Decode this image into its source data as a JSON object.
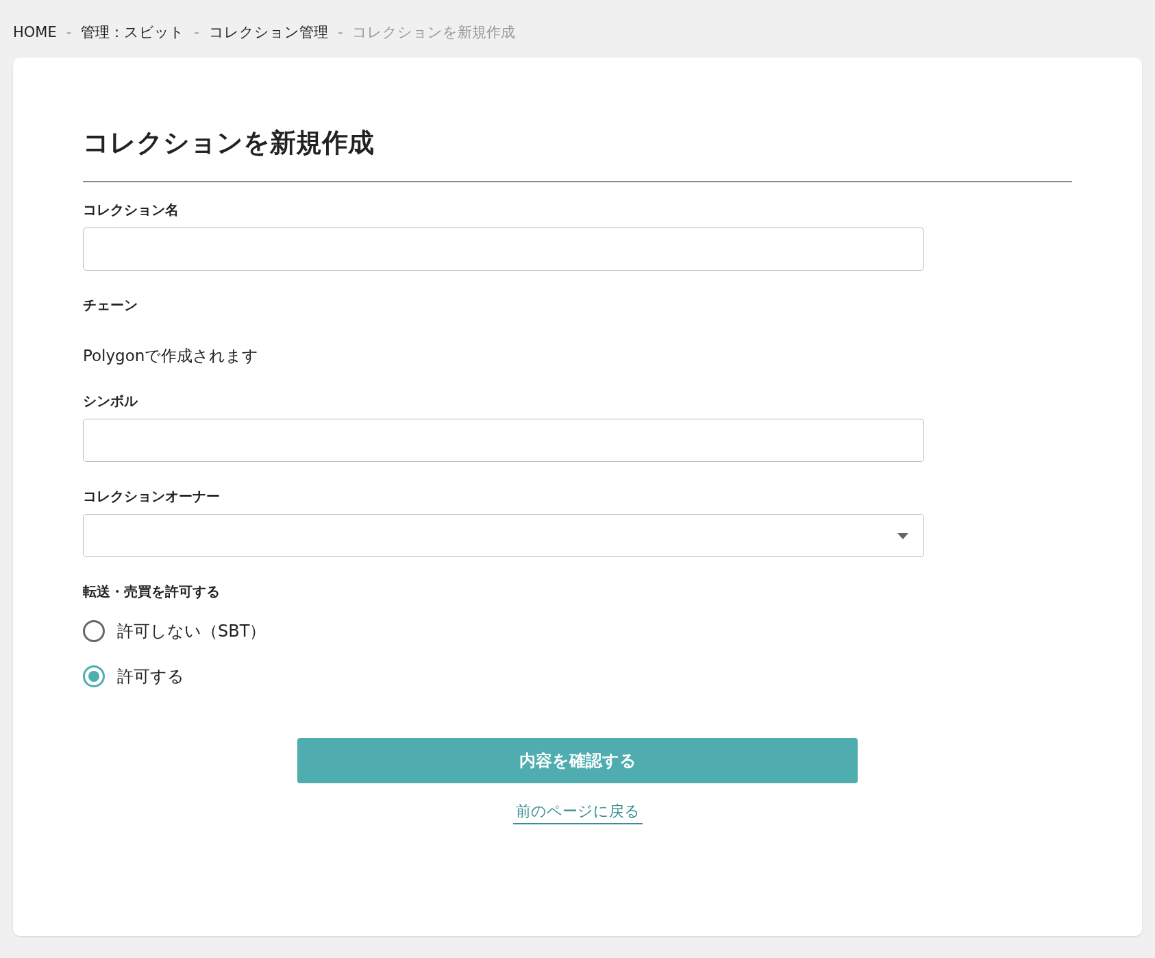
{
  "breadcrumb": [
    {
      "kind": "link",
      "label": "HOME"
    },
    {
      "kind": "separator",
      "label": "-"
    },
    {
      "kind": "link",
      "label": "管理：スビット"
    },
    {
      "kind": "separator",
      "label": "-"
    },
    {
      "kind": "link",
      "label": "コレクション管理"
    },
    {
      "kind": "separator",
      "label": "-"
    },
    {
      "kind": "current",
      "label": "コレクションを新規作成"
    }
  ],
  "title": "コレクションを新規作成",
  "fields": [
    {
      "kind": "text",
      "label": "コレクション名"
    },
    {
      "kind": "static",
      "label": "チェーン",
      "value": "Polygonで作成されます"
    },
    {
      "kind": "text",
      "label": "シンボル"
    },
    {
      "kind": "select",
      "label": "コレクションオーナー"
    },
    {
      "kind": "radio",
      "label": "転送・売買を許可する",
      "options": [
        {
          "label": "許可しない（SBT）",
          "selected": false
        },
        {
          "label": "許可する",
          "selected": true
        }
      ]
    }
  ],
  "submit": "内容を確認する",
  "back_link": "前のページに戻る"
}
